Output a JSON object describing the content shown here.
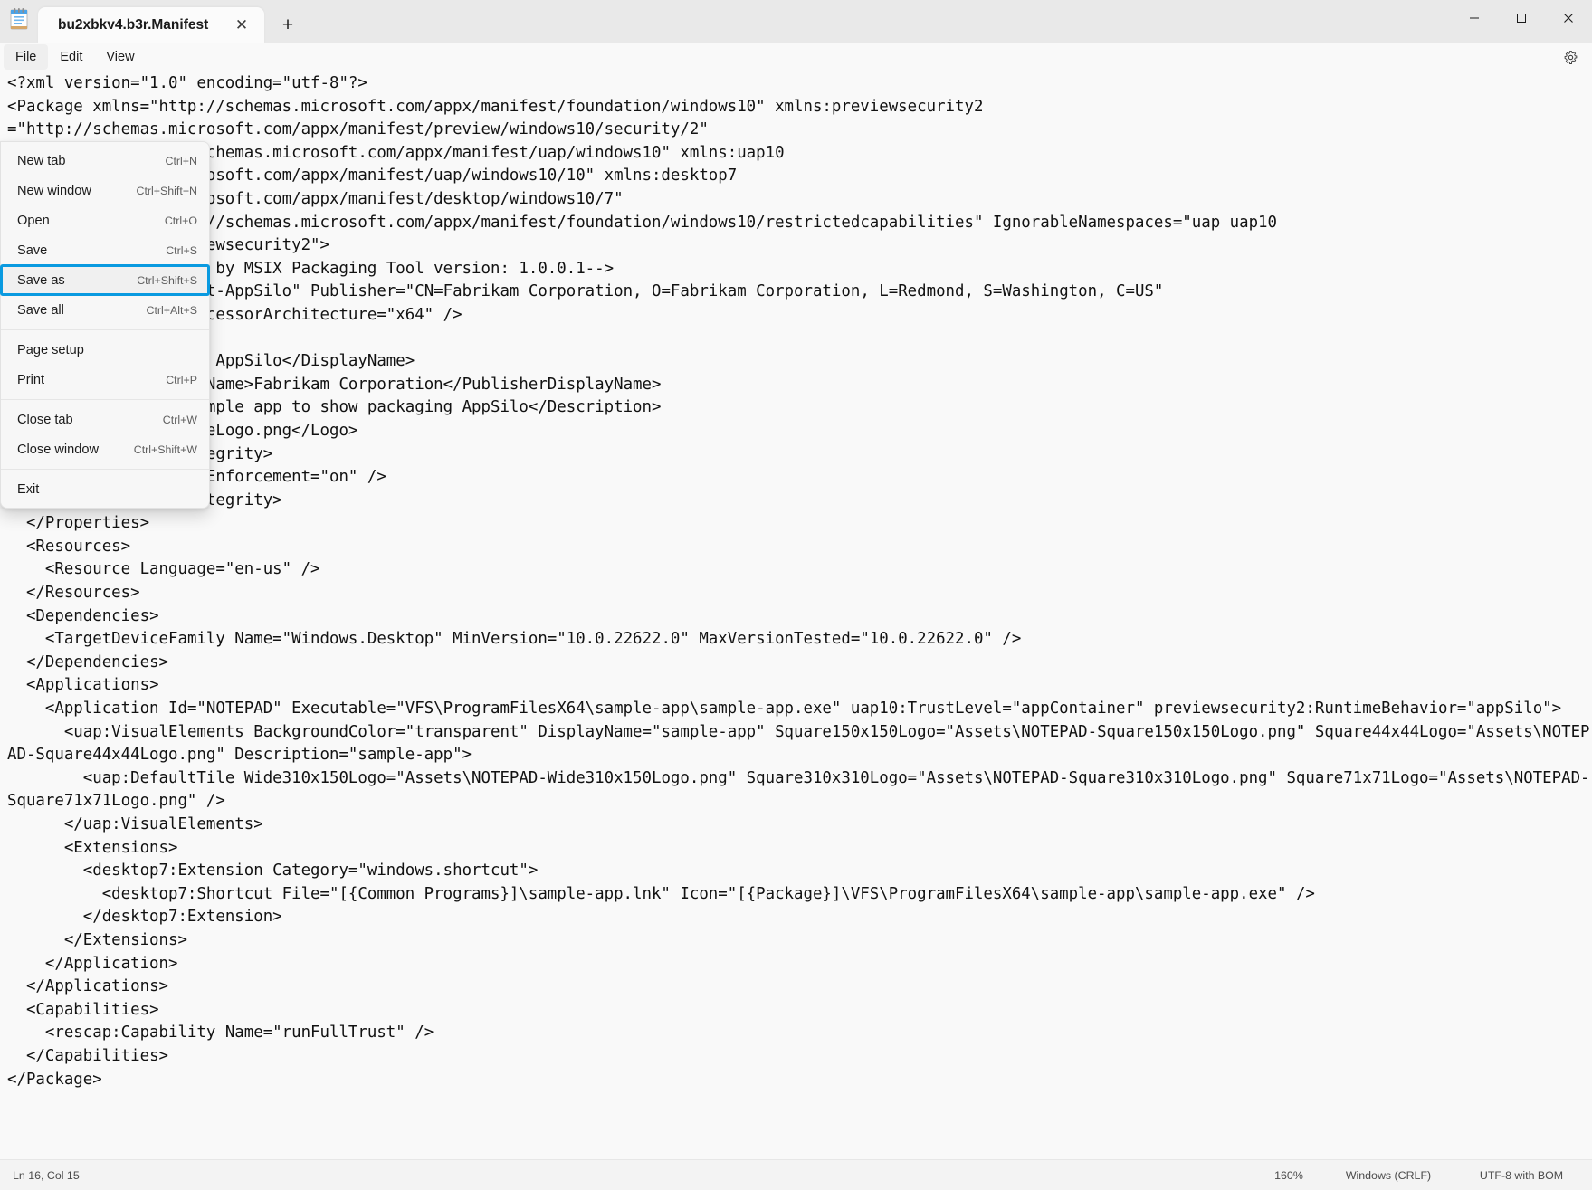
{
  "window": {
    "app_icon": "notepad-icon",
    "controls": {
      "minimize": "—",
      "maximize": "☐",
      "close": "✕"
    }
  },
  "tabs": [
    {
      "title": "bu2xbkv4.b3r.Manifest",
      "close_glyph": "✕"
    }
  ],
  "new_tab_glyph": "+",
  "menubar": {
    "items": [
      {
        "label": "File"
      },
      {
        "label": "Edit"
      },
      {
        "label": "View"
      }
    ],
    "settings_icon": "gear-icon"
  },
  "file_menu": {
    "groups": [
      {
        "items": [
          {
            "label": "New tab",
            "accel": "Ctrl+N",
            "selected": false
          },
          {
            "label": "New window",
            "accel": "Ctrl+Shift+N",
            "selected": false
          },
          {
            "label": "Open",
            "accel": "Ctrl+O",
            "selected": false
          },
          {
            "label": "Save",
            "accel": "Ctrl+S",
            "selected": false
          },
          {
            "label": "Save as",
            "accel": "Ctrl+Shift+S",
            "selected": true
          },
          {
            "label": "Save all",
            "accel": "Ctrl+Alt+S",
            "selected": false
          }
        ]
      },
      {
        "items": [
          {
            "label": "Page setup",
            "accel": "",
            "selected": false
          },
          {
            "label": "Print",
            "accel": "Ctrl+P",
            "selected": false
          }
        ]
      },
      {
        "items": [
          {
            "label": "Close tab",
            "accel": "Ctrl+W",
            "selected": false
          },
          {
            "label": "Close window",
            "accel": "Ctrl+Shift+W",
            "selected": false
          }
        ]
      },
      {
        "items": [
          {
            "label": "Exit",
            "accel": "",
            "selected": false
          }
        ]
      }
    ]
  },
  "editor": {
    "text": "<?xml version=\"1.0\" encoding=\"utf-8\"?>\n<Package xmlns=\"http://schemas.microsoft.com/appx/manifest/foundation/windows10\" xmlns:previewsecurity2\n=\"http://schemas.microsoft.com/appx/manifest/preview/windows10/security/2\"\n  xmlns:uap=\"http://schemas.microsoft.com/appx/manifest/uap/windows10\" xmlns:uap10\n=\"http://schemas.microsoft.com/appx/manifest/uap/windows10/10\" xmlns:desktop7\n=\"http://schemas.microsoft.com/appx/manifest/desktop/windows10/7\"\n  xmlns:rescap=\"http://schemas.microsoft.com/appx/manifest/foundation/windows10/restrictedcapabilities\" IgnorableNamespaces=\"uap uap10\nrescap desktop7 previewsecurity2\">\n  <!--Package created by MSIX Packaging Tool version: 1.0.0.1-->\n  <Identity Name=\"Test-AppSilo\" Publisher=\"CN=Fabrikam Corporation, O=Fabrikam Corporation, L=Redmond, S=Washington, C=US\"\nVersion=\"1.0.0.0\" ProcessorArchitecture=\"x64\" />\n  <Properties>\n    <DisplayName>Test AppSilo</DisplayName>\n    <PublisherDisplayName>Fabrikam Corporation</PublisherDisplayName>\n    <Description>A sample app to show packaging AppSilo</Description>\n    <Logo>Assets\\StoreLogo.png</Logo>\n    <uap10:PackageIntegrity>\n      <uap10:Content Enforcement=\"on\" />\n    </uap10:PackageIntegrity>\n  </Properties>\n  <Resources>\n    <Resource Language=\"en-us\" />\n  </Resources>\n  <Dependencies>\n    <TargetDeviceFamily Name=\"Windows.Desktop\" MinVersion=\"10.0.22622.0\" MaxVersionTested=\"10.0.22622.0\" />\n  </Dependencies>\n  <Applications>\n    <Application Id=\"NOTEPAD\" Executable=\"VFS\\ProgramFilesX64\\sample-app\\sample-app.exe\" uap10:TrustLevel=\"appContainer\" previewsecurity2:RuntimeBehavior=\"appSilo\">\n      <uap:VisualElements BackgroundColor=\"transparent\" DisplayName=\"sample-app\" Square150x150Logo=\"Assets\\NOTEPAD-Square150x150Logo.png\" Square44x44Logo=\"Assets\\NOTEPAD-Square44x44Logo.png\" Description=\"sample-app\">\n        <uap:DefaultTile Wide310x150Logo=\"Assets\\NOTEPAD-Wide310x150Logo.png\" Square310x310Logo=\"Assets\\NOTEPAD-Square310x310Logo.png\" Square71x71Logo=\"Assets\\NOTEPAD-Square71x71Logo.png\" />\n      </uap:VisualElements>\n      <Extensions>\n        <desktop7:Extension Category=\"windows.shortcut\">\n          <desktop7:Shortcut File=\"[{Common Programs}]\\sample-app.lnk\" Icon=\"[{Package}]\\VFS\\ProgramFilesX64\\sample-app\\sample-app.exe\" />\n        </desktop7:Extension>\n      </Extensions>\n    </Application>\n  </Applications>\n  <Capabilities>\n    <rescap:Capability Name=\"runFullTrust\" />\n  </Capabilities>\n</Package>"
  },
  "statusbar": {
    "cursor": "Ln 16, Col 15",
    "zoom": "160%",
    "line_ending": "Windows (CRLF)",
    "encoding": "UTF-8 with BOM"
  },
  "colors": {
    "accent": "#0a9ae0",
    "titlebar_bg": "#e9e9e9",
    "tab_bg": "#fbfbfb",
    "editor_bg": "#f9f9f9",
    "status_bg": "#f3f3f3"
  }
}
